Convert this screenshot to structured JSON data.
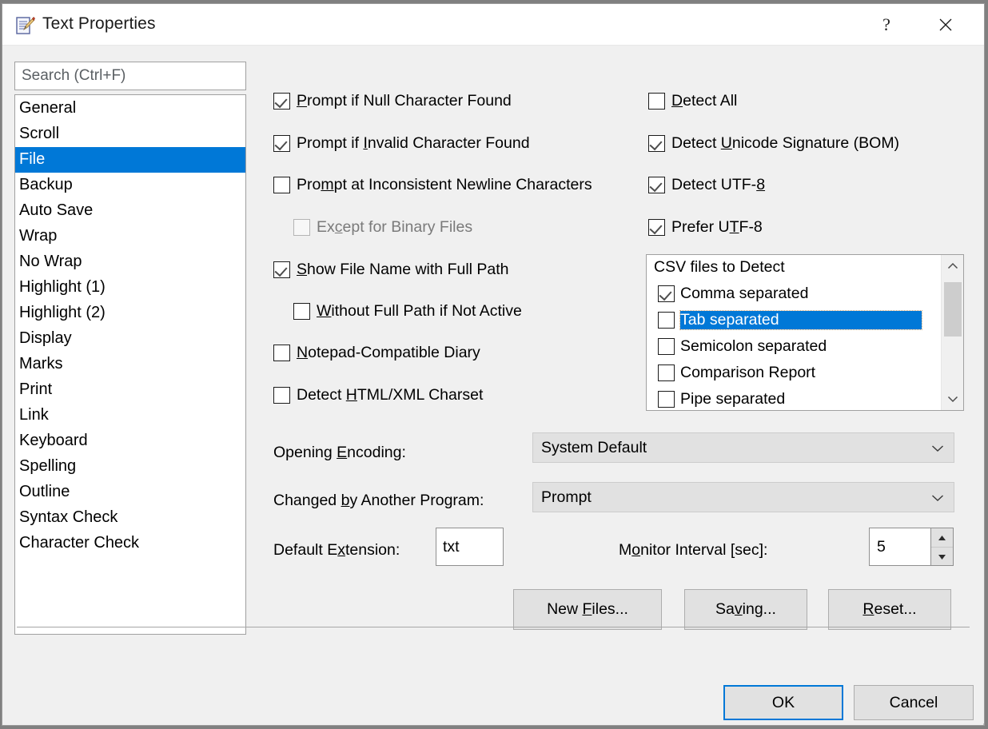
{
  "window": {
    "title": "Text Properties",
    "icon": "notepad-pencil-icon",
    "help_label": "?",
    "close_label": "✕"
  },
  "sidebar": {
    "search": {
      "placeholder": "Search (Ctrl+F)",
      "value": ""
    },
    "items": [
      {
        "label": "General",
        "selected": false
      },
      {
        "label": "Scroll",
        "selected": false
      },
      {
        "label": "File",
        "selected": true
      },
      {
        "label": "Backup",
        "selected": false
      },
      {
        "label": "Auto Save",
        "selected": false
      },
      {
        "label": "Wrap",
        "selected": false
      },
      {
        "label": "No Wrap",
        "selected": false
      },
      {
        "label": "Highlight (1)",
        "selected": false
      },
      {
        "label": "Highlight (2)",
        "selected": false
      },
      {
        "label": "Display",
        "selected": false
      },
      {
        "label": "Marks",
        "selected": false
      },
      {
        "label": "Print",
        "selected": false
      },
      {
        "label": "Link",
        "selected": false
      },
      {
        "label": "Keyboard",
        "selected": false
      },
      {
        "label": "Spelling",
        "selected": false
      },
      {
        "label": "Outline",
        "selected": false
      },
      {
        "label": "Syntax Check",
        "selected": false
      },
      {
        "label": "Character Check",
        "selected": false
      }
    ]
  },
  "main": {
    "left_checkboxes": [
      {
        "label": "Prompt if Null Character Found",
        "accel": "P",
        "checked": true,
        "disabled": false
      },
      {
        "label": "Prompt if Invalid Character Found",
        "accel": "I",
        "checked": true,
        "disabled": false
      },
      {
        "label": "Prompt at Inconsistent Newline Characters",
        "accel": "m",
        "checked": false,
        "disabled": false
      },
      {
        "label": "Except for Binary Files",
        "accel": "c",
        "checked": false,
        "disabled": true
      },
      {
        "label": "Show File Name with Full Path",
        "accel": "S",
        "checked": true,
        "disabled": false
      },
      {
        "label": "Without Full Path if Not Active",
        "accel": "W",
        "checked": false,
        "disabled": false
      },
      {
        "label": "Notepad-Compatible Diary",
        "accel": "N",
        "checked": false,
        "disabled": false
      },
      {
        "label": "Detect HTML/XML Charset",
        "accel": "H",
        "checked": false,
        "disabled": false
      }
    ],
    "right_checkboxes": [
      {
        "label": "Detect All",
        "accel": "D",
        "checked": false
      },
      {
        "label": "Detect Unicode Signature (BOM)",
        "accel": "U",
        "checked": true
      },
      {
        "label": "Detect UTF-8",
        "accel": "8",
        "checked": true
      },
      {
        "label": "Prefer UTF-8",
        "accel": "T",
        "checked": true
      }
    ],
    "csv_list": {
      "header": "CSV files to Detect",
      "rows": [
        {
          "label": "Comma separated",
          "checked": true,
          "selected": false
        },
        {
          "label": "Tab separated",
          "checked": false,
          "selected": true
        },
        {
          "label": "Semicolon separated",
          "checked": false,
          "selected": false
        },
        {
          "label": "Comparison Report",
          "checked": false,
          "selected": false
        },
        {
          "label": "Pipe separated",
          "checked": false,
          "selected": false
        }
      ]
    },
    "opening_encoding": {
      "label": "Opening Encoding:",
      "accel": "E",
      "value": "System Default"
    },
    "changed_by_another_program": {
      "label": "Changed by Another Program:",
      "accel": "b",
      "value": "Prompt"
    },
    "default_extension": {
      "label": "Default Extension:",
      "accel": "x",
      "value": "txt"
    },
    "monitor_interval": {
      "label": "Monitor Interval [sec]:",
      "accel": "o",
      "value": "5"
    },
    "buttons": [
      {
        "label": "New Files...",
        "accel": "F"
      },
      {
        "label": "Saving...",
        "accel": "v"
      },
      {
        "label": "Reset...",
        "accel": "R"
      }
    ]
  },
  "footer": {
    "ok_label": "OK",
    "cancel_label": "Cancel"
  },
  "colors": {
    "accent": "#0078d7",
    "dialog_bg": "#f0f0f0",
    "titlebar_bg": "#ffffff",
    "control_bg": "#e1e1e1",
    "selection_text": "#ffffff"
  }
}
